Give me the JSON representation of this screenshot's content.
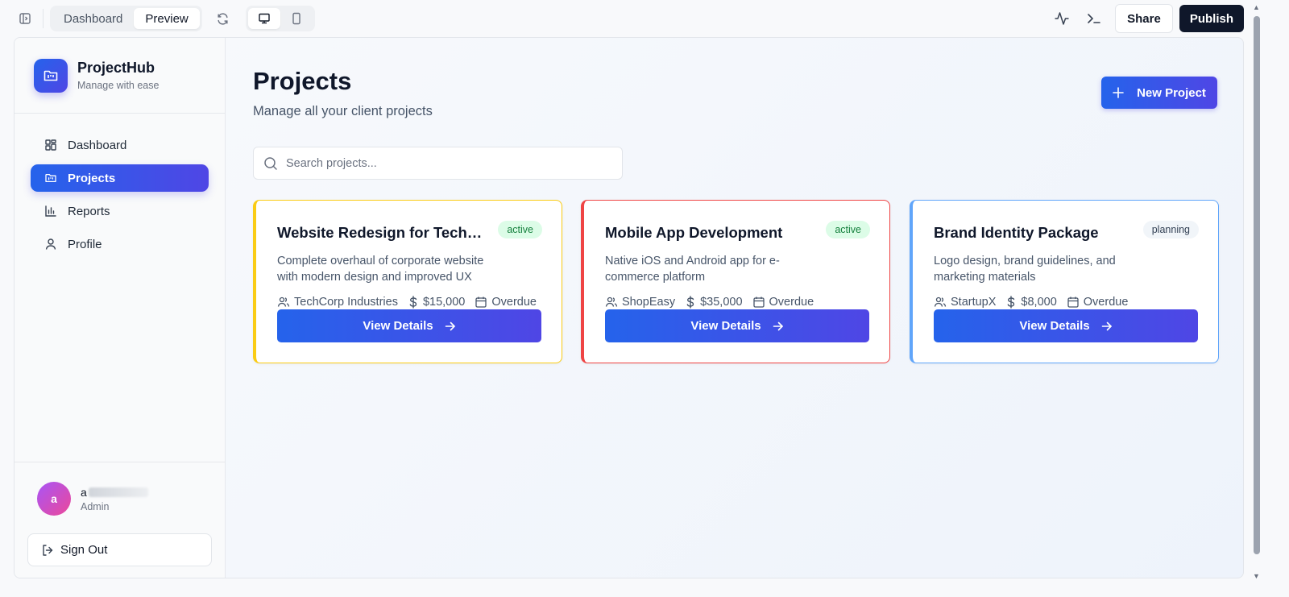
{
  "topbar": {
    "tabs": [
      {
        "label": "Dashboard",
        "active": false
      },
      {
        "label": "Preview",
        "active": true
      }
    ],
    "share_label": "Share",
    "publish_label": "Publish"
  },
  "sidebar": {
    "brand_name": "ProjectHub",
    "brand_tagline": "Manage with ease",
    "items": [
      {
        "label": "Dashboard",
        "icon": "grid-icon",
        "active": false
      },
      {
        "label": "Projects",
        "icon": "folder-kanban-icon",
        "active": true
      },
      {
        "label": "Reports",
        "icon": "bar-chart-icon",
        "active": false
      },
      {
        "label": "Profile",
        "icon": "user-icon",
        "active": false
      }
    ],
    "user": {
      "avatar_letter": "a",
      "name_visible": "a",
      "role": "Admin"
    },
    "signout_label": "Sign Out"
  },
  "main": {
    "title": "Projects",
    "subtitle": "Manage all your client projects",
    "new_project_label": "New Project",
    "search_placeholder": "Search projects...",
    "projects": [
      {
        "title": "Website Redesign for TechCorp",
        "status": "active",
        "description": "Complete overhaul of corporate website with modern design and improved UX",
        "client": "TechCorp Industries",
        "budget": "$15,000",
        "due": "Overdue",
        "accent": "#facc15",
        "button_label": "View Details"
      },
      {
        "title": "Mobile App Development",
        "status": "active",
        "description": "Native iOS and Android app for e-commerce platform",
        "client": "ShopEasy",
        "budget": "$35,000",
        "due": "Overdue",
        "accent": "#ef4444",
        "button_label": "View Details"
      },
      {
        "title": "Brand Identity Package",
        "status": "planning",
        "description": "Logo design, brand guidelines, and marketing materials",
        "client": "StartupX",
        "budget": "$8,000",
        "due": "Overdue",
        "accent": "#60a5fa",
        "button_label": "View Details"
      }
    ]
  },
  "colors": {
    "primary_gradient_start": "#2563eb",
    "primary_gradient_end": "#4f46e5",
    "active_badge_bg": "#dcfce7",
    "active_badge_text": "#15803d",
    "planning_badge_bg": "#f1f5f9",
    "planning_badge_text": "#334155"
  }
}
